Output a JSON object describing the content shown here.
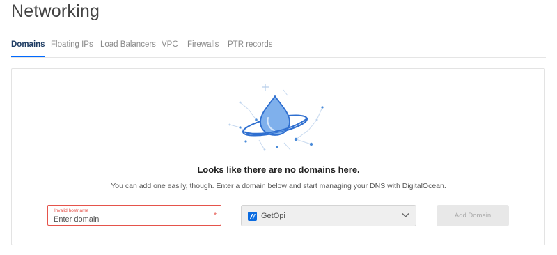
{
  "page": {
    "title": "Networking"
  },
  "tabs": [
    {
      "label": "Domains",
      "active": true
    },
    {
      "label": "Floating IPs",
      "active": false
    },
    {
      "label": "Load Balancers",
      "active": false
    },
    {
      "label": "VPC",
      "active": false
    },
    {
      "label": "Firewalls",
      "active": false
    },
    {
      "label": "PTR records",
      "active": false
    }
  ],
  "empty_state": {
    "illustration_icon": "water-drop-planet-icon",
    "title": "Looks like there are no domains here.",
    "description": "You can add one easily, though. Enter a domain below and start managing your DNS with DigitalOcean."
  },
  "form": {
    "domain_field": {
      "error_label": "Invalid hostname",
      "placeholder": "Enter domain",
      "value": "",
      "required_mark": "*"
    },
    "project_select": {
      "selected": "GetOpi",
      "icon": "project-icon"
    },
    "add_button_label": "Add Domain"
  },
  "colors": {
    "accent": "#0069ff",
    "active_tab_text": "#1e3c63",
    "error": "#e5534b",
    "disabled_button_bg": "#e8e8e8",
    "disabled_button_text": "#a9a9a9"
  }
}
